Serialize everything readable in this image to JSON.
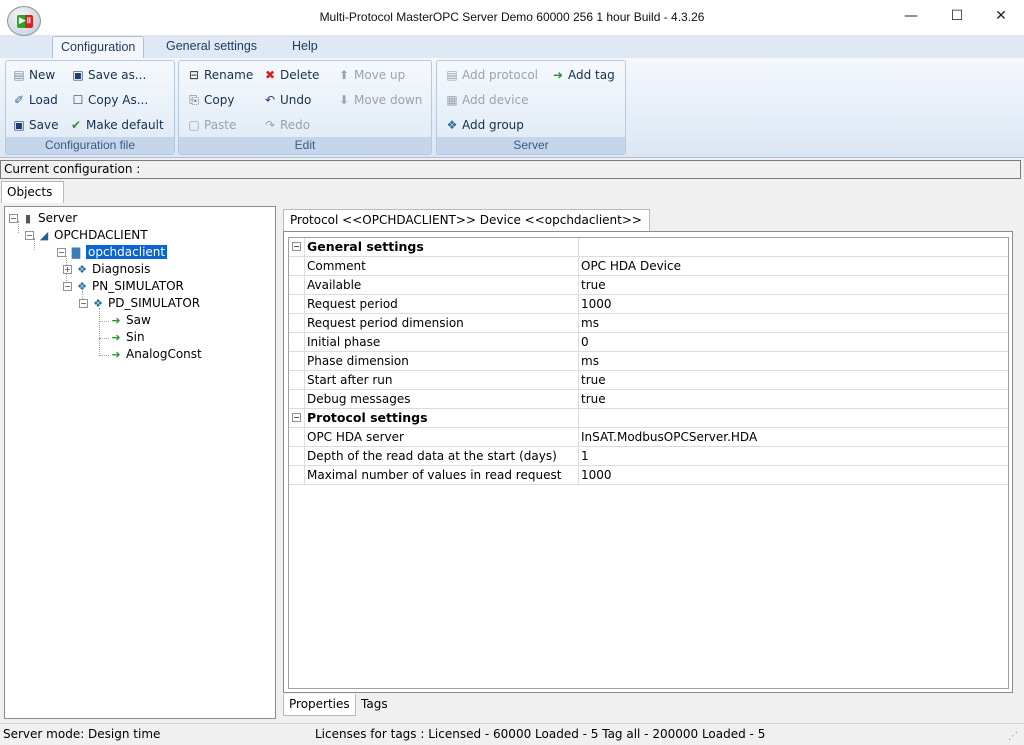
{
  "window": {
    "title": "Multi-Protocol MasterOPC Server Demo 60000 256 1 hour Build - 4.3.26",
    "minimize": "—",
    "maximize": "☐",
    "close": "✕"
  },
  "ribbon_tabs": [
    "Configuration",
    "General settings",
    "Help"
  ],
  "ribbon": {
    "config_file": {
      "label": "Configuration file",
      "new": "New",
      "save_as": "Save as...",
      "load": "Load",
      "copy_as": "Copy As...",
      "save": "Save",
      "make_default": "Make default"
    },
    "edit": {
      "label": "Edit",
      "rename": "Rename",
      "delete": "Delete",
      "move_up": "Move up",
      "copy": "Copy",
      "undo": "Undo",
      "move_down": "Move down",
      "paste": "Paste",
      "redo": "Redo"
    },
    "server": {
      "label": "Server",
      "add_protocol": "Add protocol",
      "add_tag": "Add tag",
      "add_device": "Add device",
      "add_group": "Add group"
    }
  },
  "current_configuration": "Current configuration :",
  "objects_tab": "Objects",
  "tree": {
    "server": "Server",
    "protocol": "OPCHDACLIENT",
    "device": "opchdaclient",
    "group_diagnosis": "Diagnosis",
    "group_pn": "PN_SIMULATOR",
    "group_pd": "PD_SIMULATOR",
    "tag_saw": "Saw",
    "tag_sin": "Sin",
    "tag_analog": "AnalogConst"
  },
  "panel_tab": "Protocol <<OPCHDACLIENT>> Device <<opchdaclient>>",
  "properties": [
    {
      "name": "General settings",
      "value": "",
      "category": true
    },
    {
      "name": "Comment",
      "value": "OPC HDA Device"
    },
    {
      "name": "Available",
      "value": "true"
    },
    {
      "name": "Request period",
      "value": "1000"
    },
    {
      "name": "Request period dimension",
      "value": "ms"
    },
    {
      "name": "Initial phase",
      "value": "0"
    },
    {
      "name": "Phase dimension",
      "value": "ms"
    },
    {
      "name": "Start after run",
      "value": "true"
    },
    {
      "name": "Debug messages",
      "value": "true"
    },
    {
      "name": "Protocol settings",
      "value": "",
      "category": true
    },
    {
      "name": "OPC HDA server",
      "value": "InSAT.ModbusOPCServer.HDA"
    },
    {
      "name": "Depth of the read data at the start (days)",
      "value": "1"
    },
    {
      "name": "Maximal number of values in read request",
      "value": "1000"
    }
  ],
  "bottom_tabs": [
    "Properties",
    "Tags"
  ],
  "status": {
    "mode": "Server mode: Design time",
    "licenses": "Licenses for tags : Licensed - 60000  Loaded - 5 Tag all - 200000  Loaded - 5"
  },
  "colors": {
    "selection": "#0a64d2",
    "ribbon_group_label": "#c5d6ea",
    "delete_icon": "#e01c1c",
    "green_icon": "#2a9a2a"
  }
}
